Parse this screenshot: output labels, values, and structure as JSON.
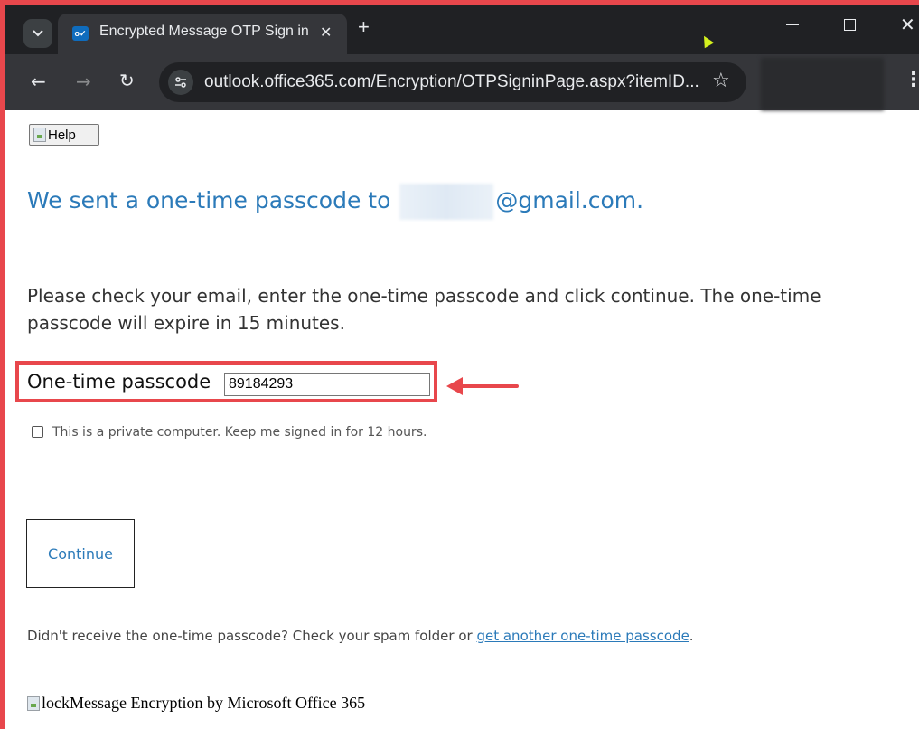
{
  "browser": {
    "tab_title": "Encrypted Message OTP Sign in",
    "tab_close": "✕",
    "new_tab": "+",
    "favicon_text": "o✓",
    "url": "outlook.office365.com/Encryption/OTPSigninPage.aspx?itemID...",
    "icons": [
      "chevron-down-icon",
      "outlook-icon",
      "close-icon",
      "plus-icon",
      "minimize-icon",
      "maximize-icon",
      "close-window-icon",
      "back-arrow-icon",
      "forward-arrow-icon",
      "reload-icon",
      "site-info-icon",
      "star-icon",
      "kebab-menu-icon"
    ]
  },
  "page": {
    "help_label": "Help",
    "headline_prefix": "We sent a one-time passcode to",
    "headline_suffix": "@gmail.com.",
    "instructions": "Please check your email, enter the one-time passcode and click continue. The one-time passcode will expire in 15 minutes.",
    "otp_label": "One-time passcode",
    "otp_value": "89184293",
    "keep_signed_in": "This is a private computer. Keep me signed in for 12 hours.",
    "continue_label": "Continue",
    "resend_prefix": "Didn't receive the one-time passcode? Check your spam folder or",
    "resend_link": "get another one-time passcode",
    "resend_suffix": ".",
    "footer_alt": "lock",
    "footer_text": "Message Encryption by Microsoft Office 365"
  },
  "colors": {
    "annotation_red": "#e8474c",
    "link_blue": "#2b7ab9",
    "chrome_dark": "#202124"
  }
}
